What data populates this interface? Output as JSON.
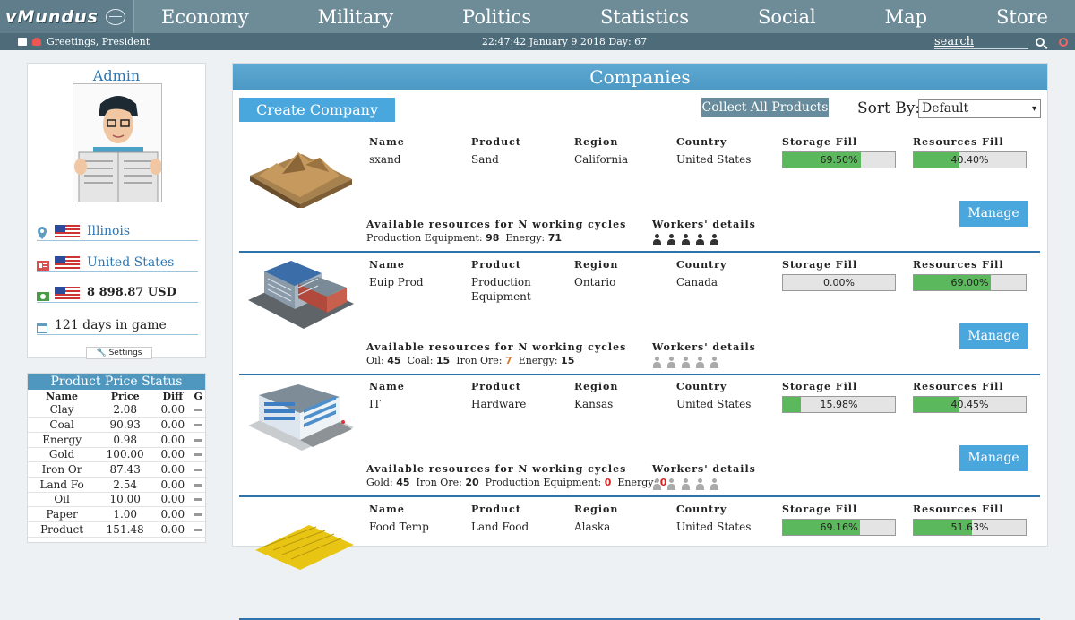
{
  "nav": {
    "logo_text": "vMundus",
    "items": [
      "Economy",
      "Military",
      "Politics",
      "Statistics",
      "Social",
      "Map",
      "Store"
    ]
  },
  "status": {
    "greeting": "Greetings, President",
    "datetime": "22:47:42 January 9 2018  Day: 67",
    "search_label": "search"
  },
  "profile": {
    "name": "Admin",
    "region": "Illinois",
    "country": "United States",
    "money": "8 898.87 USD",
    "days": "121 days in game",
    "settings_label": "Settings"
  },
  "prices": {
    "title": "Product Price Status",
    "headers": [
      "Name",
      "Price",
      "Diff",
      "G"
    ],
    "rows": [
      {
        "name": "Clay",
        "price": "2.08",
        "diff": "0.00"
      },
      {
        "name": "Coal",
        "price": "90.93",
        "diff": "0.00"
      },
      {
        "name": "Energy",
        "price": "0.98",
        "diff": "0.00"
      },
      {
        "name": "Gold",
        "price": "100.00",
        "diff": "0.00"
      },
      {
        "name": "Iron Or",
        "price": "87.43",
        "diff": "0.00"
      },
      {
        "name": "Land Fo",
        "price": "2.54",
        "diff": "0.00"
      },
      {
        "name": "Oil",
        "price": "10.00",
        "diff": "0.00"
      },
      {
        "name": "Paper",
        "price": "1.00",
        "diff": "0.00"
      },
      {
        "name": "Product",
        "price": "151.48",
        "diff": "0.00"
      }
    ]
  },
  "main": {
    "title": "Companies",
    "create_label": "Create Company",
    "collect_label": "Collect All Products",
    "sort_label": "Sort By:",
    "sort_value": "Default",
    "col_headers": {
      "name": "Name",
      "product": "Product",
      "region": "Region",
      "country": "Country",
      "storage": "Storage Fill",
      "resources": "Resources Fill"
    },
    "avail_label": "Available resources for N working cycles",
    "workers_label": "Workers' details",
    "manage_label": "Manage",
    "companies": [
      {
        "name": "sxand",
        "product": "Sand",
        "region": "California",
        "country": "United States",
        "storage": "69.50%",
        "storage_value": 69.5,
        "resources": "40.40%",
        "resources_value": 40.4,
        "resources_list": [
          {
            "label": "Production Equipment:",
            "value": "98"
          },
          {
            "label": "Energy:",
            "value": "71"
          }
        ],
        "workers_active": true,
        "image": "mountain"
      },
      {
        "name": "Euip Prod",
        "product": "Production Equipment",
        "region": "Ontario",
        "country": "Canada",
        "storage": "0.00%",
        "storage_value": 0,
        "resources": "69.00%",
        "resources_value": 69.0,
        "resources_list": [
          {
            "label": "Oil:",
            "value": "45"
          },
          {
            "label": "Coal:",
            "value": "15"
          },
          {
            "label": "Iron Ore:",
            "value": "7",
            "warn": "orange"
          },
          {
            "label": "Energy:",
            "value": "15"
          }
        ],
        "workers_active": false,
        "image": "factory"
      },
      {
        "name": "IT",
        "product": "Hardware",
        "region": "Kansas",
        "country": "United States",
        "storage": "15.98%",
        "storage_value": 15.98,
        "resources": "40.45%",
        "resources_value": 40.45,
        "resources_list": [
          {
            "label": "Gold:",
            "value": "45"
          },
          {
            "label": "Iron Ore:",
            "value": "20"
          },
          {
            "label": "Production Equipment:",
            "value": "0",
            "warn": "red"
          },
          {
            "label": "Energy:",
            "value": "0",
            "warn": "red"
          }
        ],
        "workers_active": false,
        "image": "office"
      },
      {
        "name": "Food Temp",
        "product": "Land Food",
        "region": "Alaska",
        "country": "United States",
        "storage": "69.16%",
        "storage_value": 69.16,
        "resources": "51.63%",
        "resources_value": 51.63,
        "resources_list": [],
        "workers_active": false,
        "image": "field"
      }
    ]
  },
  "colors": {
    "accent": "#49a7dd",
    "nav": "#6e8b98",
    "fill": "#5cb85c"
  }
}
